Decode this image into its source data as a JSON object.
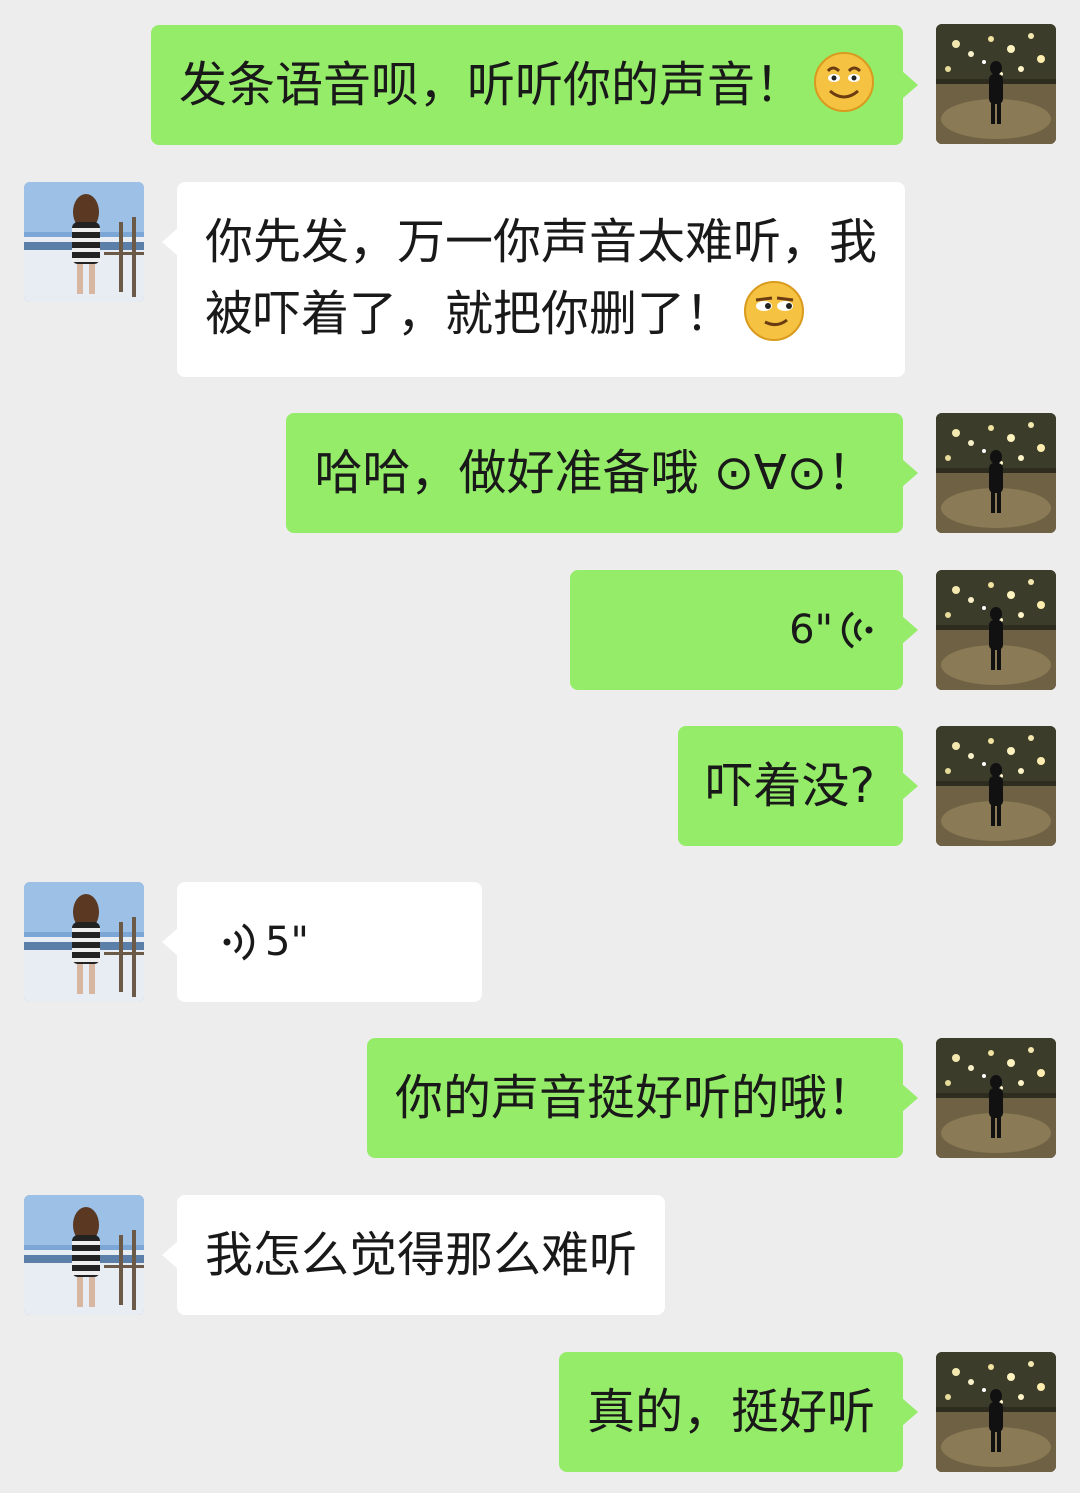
{
  "messages": [
    {
      "from": "me",
      "type": "text",
      "text": "发条语音呗，听听你的声音！",
      "emoji": "smiling-face-emoji"
    },
    {
      "from": "her",
      "type": "text",
      "line1": "你先发，万一你声音太难听，我",
      "line2": "被吓着了，就把你删了！",
      "emoji": "smirking-face-emoji"
    },
    {
      "from": "me",
      "type": "text",
      "text": "哈哈，做好准备哦 ⊙∀⊙！"
    },
    {
      "from": "me",
      "type": "voice",
      "duration": "6\"",
      "icon": "voice-wave-icon"
    },
    {
      "from": "me",
      "type": "text",
      "text": "吓着没?"
    },
    {
      "from": "her",
      "type": "voice",
      "duration": "5\"",
      "icon": "voice-wave-icon"
    },
    {
      "from": "me",
      "type": "text",
      "text": "你的声音挺好听的哦！"
    },
    {
      "from": "her",
      "type": "text",
      "text": "我怎么觉得那么难听"
    },
    {
      "from": "me",
      "type": "text",
      "text": "真的，挺好听"
    }
  ],
  "colors": {
    "background": "#ededed",
    "my_bubble": "#95ec69",
    "her_bubble": "#ffffff",
    "text": "#191919"
  }
}
